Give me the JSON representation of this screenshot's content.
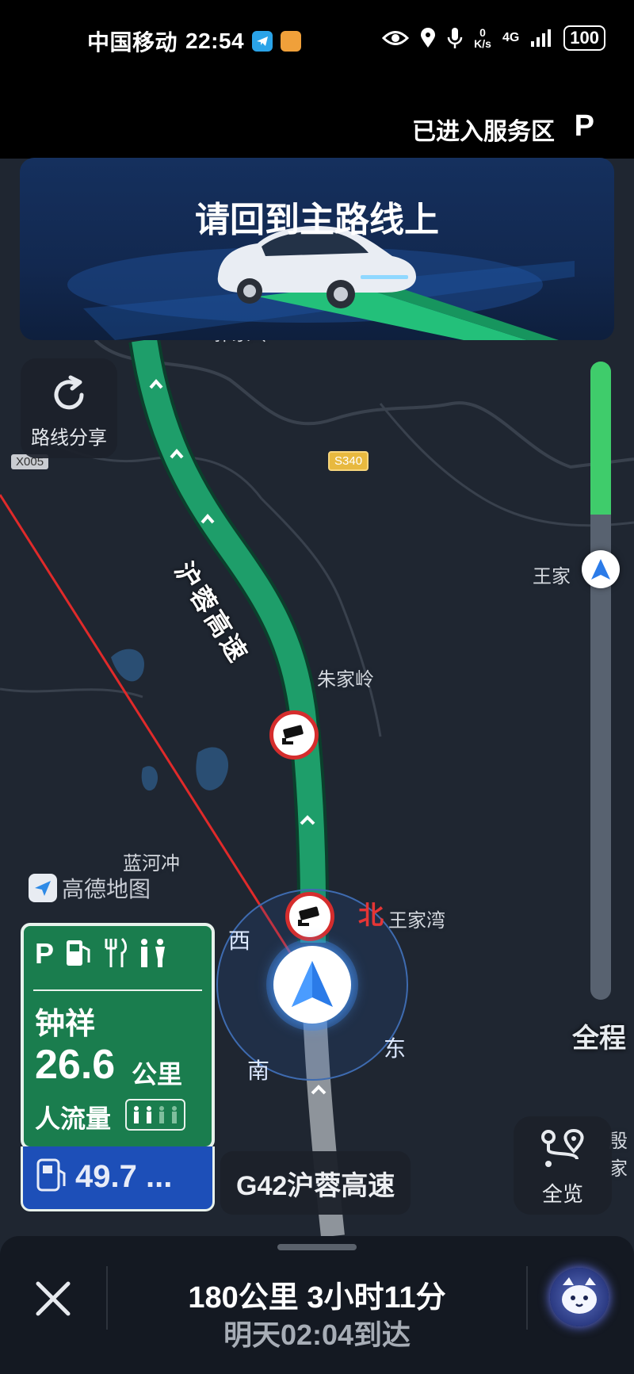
{
  "status_bar": {
    "carrier": "中国移动",
    "time": "22:54",
    "net_speed_value": "0",
    "net_speed_unit": "K/s",
    "network": "4G",
    "battery": "100"
  },
  "service_area": {
    "status_text": "已进入服务区",
    "icon_letter": "P"
  },
  "banner": {
    "title": "请回到主路线上"
  },
  "map": {
    "places": [
      "郭家岭",
      "朱家岭",
      "蓝河冲",
      "王家湾",
      "王家",
      "殷家"
    ],
    "road_shields": [
      "S340",
      "X005"
    ],
    "highway_label": "沪蓉高速",
    "compass": {
      "north": "北",
      "west": "西",
      "south": "南",
      "east": "东"
    },
    "logo_text": "高德地图"
  },
  "share_button": {
    "label": "路线分享"
  },
  "progress": {
    "label": "全程",
    "completed_fraction": 0.24
  },
  "service_sign": {
    "name": "钟祥",
    "distance": "26.6",
    "unit": "公里",
    "crowd_label": "人流量",
    "next_value": "49.7 ..."
  },
  "current_road": "G42沪蓉高速",
  "overview_button": {
    "label": "全览"
  },
  "trip": {
    "summary": "180公里  3小时11分",
    "eta": "明天02:04到达"
  },
  "colors": {
    "route": "#1e9e6a",
    "accent_blue": "#2b7be8",
    "progress_green": "#3fcc6b",
    "sign_green": "#1a7d4e",
    "sign_blue": "#1d4fb8"
  }
}
